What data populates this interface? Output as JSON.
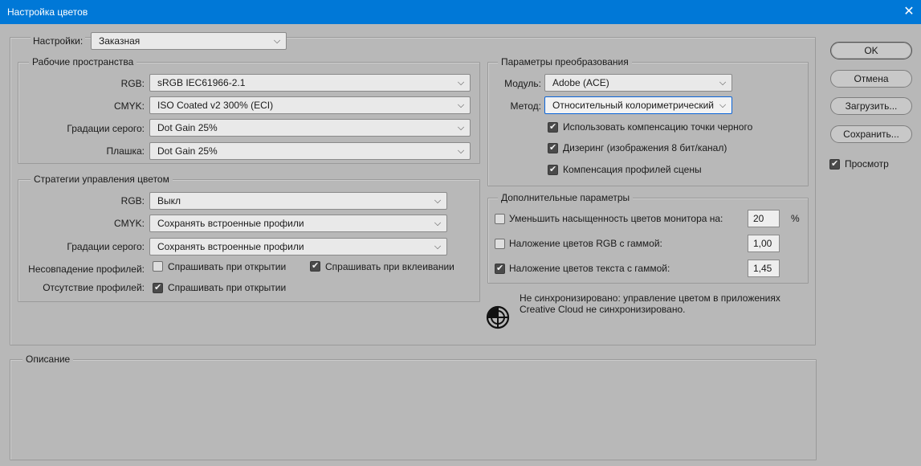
{
  "window": {
    "title": "Настройка цветов",
    "close_glyph": "✕"
  },
  "settings": {
    "label": "Настройки:",
    "value": "Заказная"
  },
  "working_spaces": {
    "title": "Рабочие пространства",
    "rows": [
      {
        "label": "RGB:",
        "value": "sRGB IEC61966-2.1"
      },
      {
        "label": "CMYK:",
        "value": "ISO Coated v2 300% (ECI)"
      },
      {
        "label": "Градации серого:",
        "value": "Dot Gain 25%"
      },
      {
        "label": "Плашка:",
        "value": "Dot Gain 25%"
      }
    ]
  },
  "policies": {
    "title": "Стратегии управления цветом",
    "rows": [
      {
        "label": "RGB:",
        "value": "Выкл"
      },
      {
        "label": "CMYK:",
        "value": "Сохранять встроенные профили"
      },
      {
        "label": "Градации серого:",
        "value": "Сохранять встроенные профили"
      }
    ],
    "mismatch": {
      "label": "Несовпадение профилей:",
      "ask_open": {
        "label": "Спрашивать при открытии",
        "checked": false
      },
      "ask_paste": {
        "label": "Спрашивать при вклеивании",
        "checked": true
      }
    },
    "missing": {
      "label": "Отсутствие профилей:",
      "ask_open": {
        "label": "Спрашивать при открытии",
        "checked": true
      }
    }
  },
  "conversion": {
    "title": "Параметры преобразования",
    "engine": {
      "label": "Модуль:",
      "value": "Adobe (ACE)"
    },
    "intent": {
      "label": "Метод:",
      "value": "Относительный колориметрический"
    },
    "options": [
      {
        "label": "Использовать компенсацию точки черного",
        "checked": true
      },
      {
        "label": "Дизеринг (изображения 8 бит/канал)",
        "checked": true
      },
      {
        "label": "Компенсация профилей сцены",
        "checked": true
      }
    ]
  },
  "advanced": {
    "title": "Дополнительные параметры",
    "rows": [
      {
        "label": "Уменьшить насыщенность цветов монитора на:",
        "value": "20",
        "unit": "%",
        "checked": false
      },
      {
        "label": "Наложение цветов RGB с гаммой:",
        "value": "1,00",
        "checked": false
      },
      {
        "label": "Наложение цветов текста с гаммой:",
        "value": "1,45",
        "checked": true
      }
    ]
  },
  "sync": {
    "line1": "Не синхронизировано: управление цветом в приложениях",
    "line2": "Creative Cloud не синхронизировано.",
    "icon": "sync-status-icon"
  },
  "description": {
    "title": "Описание"
  },
  "buttons": {
    "ok": "OK",
    "cancel": "Отмена",
    "load": "Загрузить...",
    "save": "Сохранить..."
  },
  "preview": {
    "label": "Просмотр",
    "checked": true
  }
}
